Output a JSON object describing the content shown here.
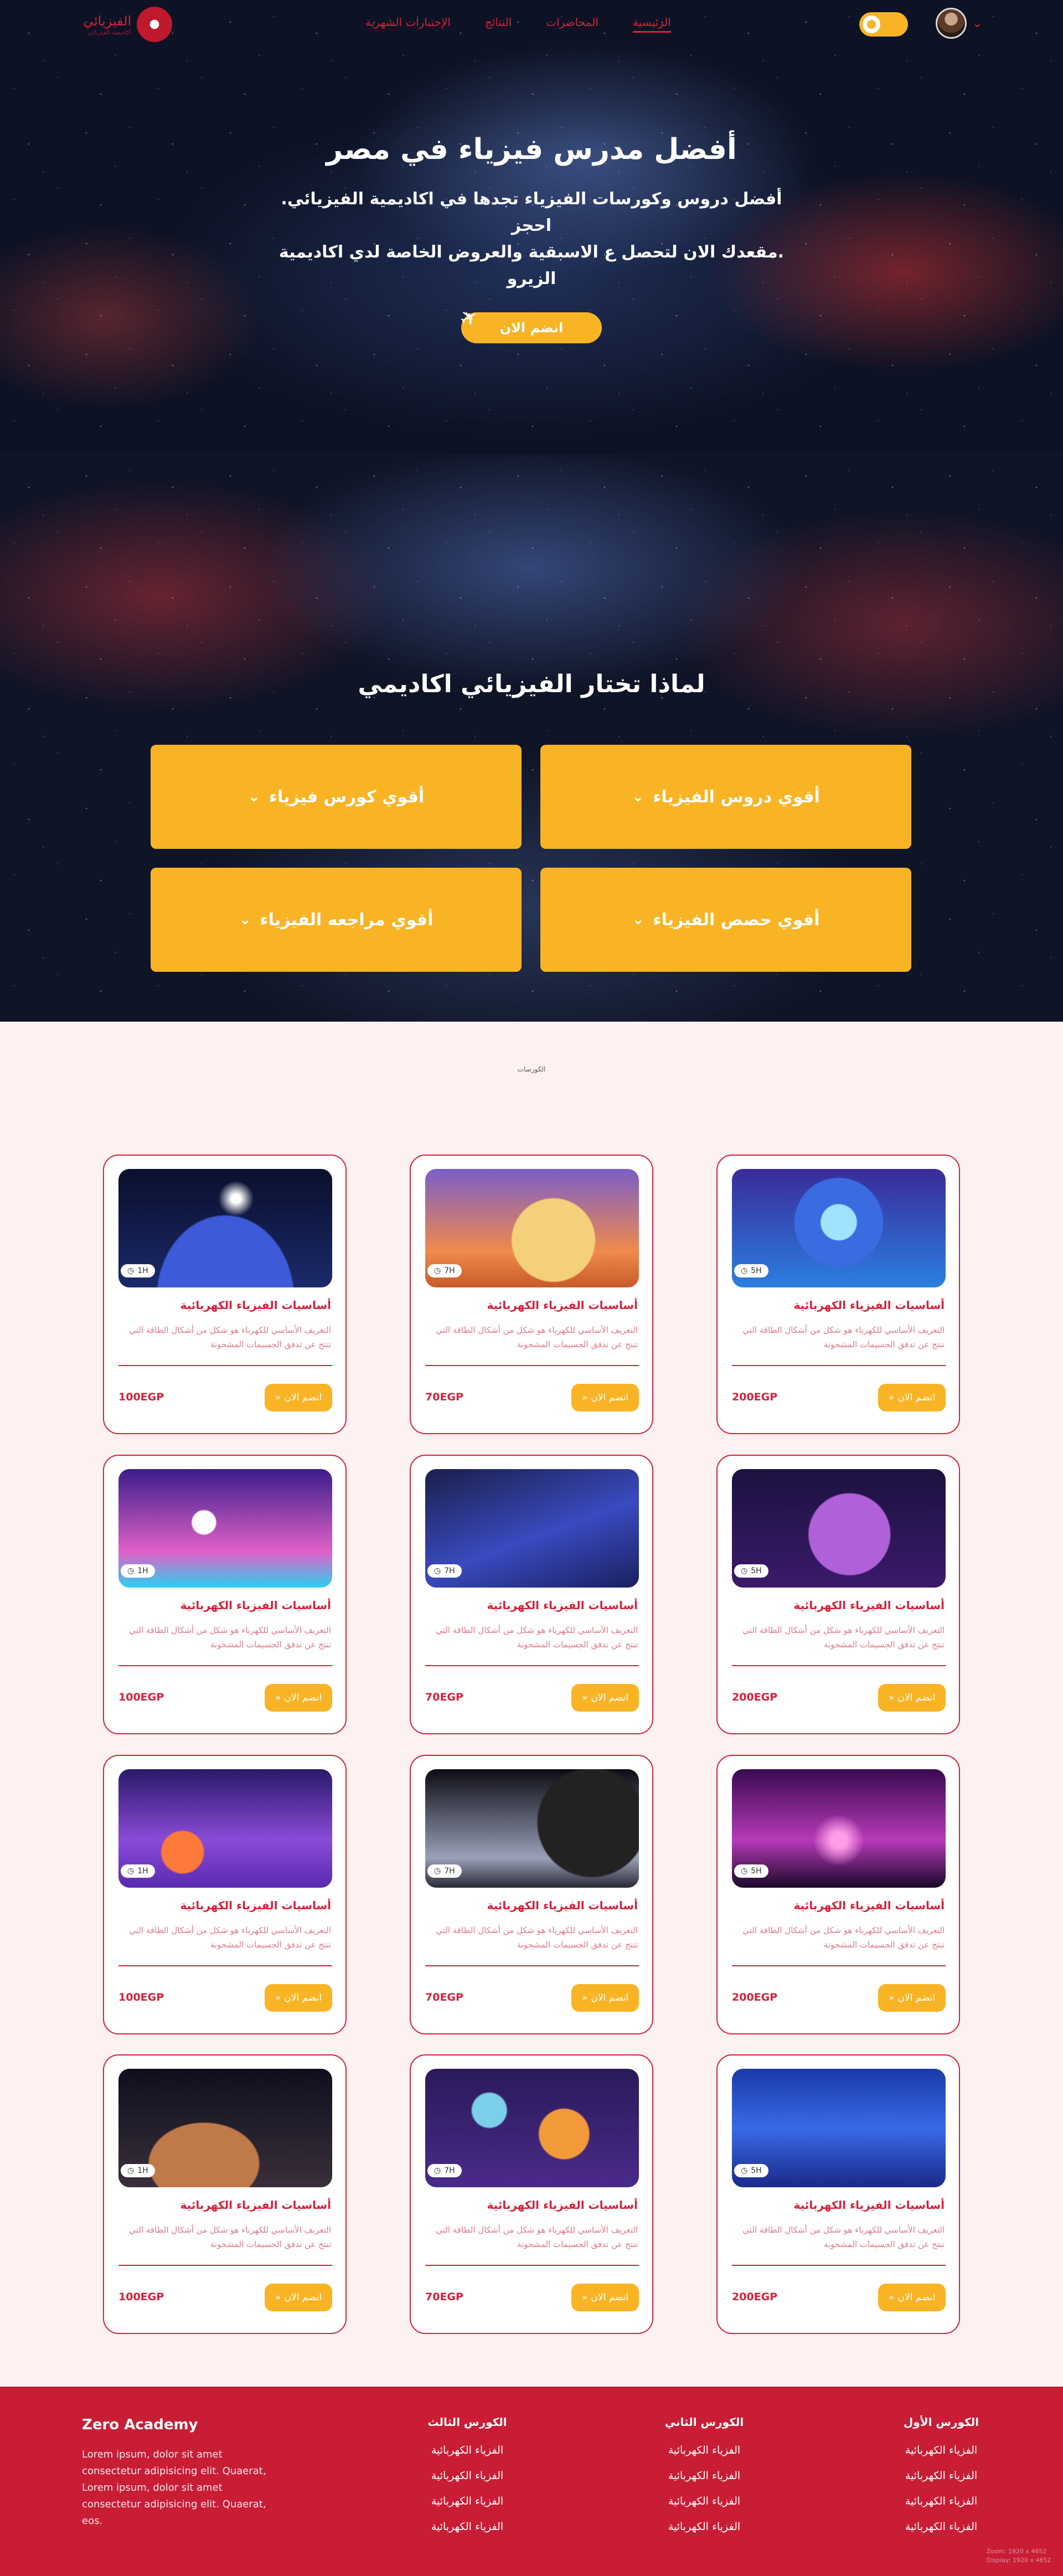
{
  "nav": {
    "links": [
      "الرئيسية",
      "المحاضرات",
      "النتائج",
      "الإختبارات الشهرية"
    ],
    "brand_title": "الفيزيائي",
    "brand_sub": "اكاديمية الفيزيائي",
    "theme_toggle": "sun-icon"
  },
  "hero": {
    "title": "أفضل مدرس فيزياء في مصر",
    "line1": "أفضل دروس وكورسات الفيزياء تجدها في اكاديمية الفيزيائي. احجز",
    "line2": ".مقعدك الان لتحصل ع الاسبقية والعروض الخاصة لدي اكاديمية الزيرو",
    "cta": "انضم الان"
  },
  "why": {
    "title": "لماذا تختار الفيزيائي اكاديمي",
    "features": [
      "أقوي دروس الفيزياء",
      "أقوي كورس فيزياء",
      "أقوي حصص الفيزياء",
      "أقوي مراجعه الفيزياء"
    ]
  },
  "courses_title": "الكورسات",
  "courses": [
    {
      "duration": "5H",
      "title": "أساسيات الفيزياء الكهربائية",
      "desc": "التعريف الأساسي للكهرباء هو شكل من أشكال الطاقة التي تنتج عن تدفق الجسيمات المشحونة",
      "price": "200EGP",
      "button": "انضم الان"
    },
    {
      "duration": "7H",
      "title": "أساسيات الفيزياء الكهربائية",
      "desc": "التعريف الأساسي للكهرباء هو شكل من أشكال الطاقة التي تنتج عن تدفق الجسيمات المشحونة",
      "price": "70EGP",
      "button": "انضم الان"
    },
    {
      "duration": "1H",
      "title": "أساسيات الفيزياء الكهربائية",
      "desc": "التعريف الأساسي للكهرباء هو شكل من أشكال الطاقة التي تنتج عن تدفق الجسيمات المشحونة",
      "price": "100EGP",
      "button": "انضم الان"
    },
    {
      "duration": "5H",
      "title": "أساسيات الفيزياء الكهربائية",
      "desc": "التعريف الأساسي للكهرباء هو شكل من أشكال الطاقة التي تنتج عن تدفق الجسيمات المشحونة",
      "price": "200EGP",
      "button": "انضم الان"
    },
    {
      "duration": "7H",
      "title": "أساسيات الفيزياء الكهربائية",
      "desc": "التعريف الأساسي للكهرباء هو شكل من أشكال الطاقة التي تنتج عن تدفق الجسيمات المشحونة",
      "price": "70EGP",
      "button": "انضم الان"
    },
    {
      "duration": "1H",
      "title": "أساسيات الفيزياء الكهربائية",
      "desc": "التعريف الأساسي للكهرباء هو شكل من أشكال الطاقة التي تنتج عن تدفق الجسيمات المشحونة",
      "price": "100EGP",
      "button": "انضم الان"
    },
    {
      "duration": "5H",
      "title": "أساسيات الفيزياء الكهربائية",
      "desc": "التعريف الأساسي للكهرباء هو شكل من أشكال الطاقة التي تنتج عن تدفق الجسيمات المشحونة",
      "price": "200EGP",
      "button": "انضم الان"
    },
    {
      "duration": "7H",
      "title": "أساسيات الفيزياء الكهربائية",
      "desc": "التعريف الأساسي للكهرباء هو شكل من أشكال الطاقة التي تنتج عن تدفق الجسيمات المشحونة",
      "price": "70EGP",
      "button": "انضم الان"
    },
    {
      "duration": "1H",
      "title": "أساسيات الفيزياء الكهربائية",
      "desc": "التعريف الأساسي للكهرباء هو شكل من أشكال الطاقة التي تنتج عن تدفق الجسيمات المشحونة",
      "price": "100EGP",
      "button": "انضم الان"
    },
    {
      "duration": "5H",
      "title": "أساسيات الفيزياء الكهربائية",
      "desc": "التعريف الأساسي للكهرباء هو شكل من أشكال الطاقة التي تنتج عن تدفق الجسيمات المشحونة",
      "price": "200EGP",
      "button": "انضم الان"
    },
    {
      "duration": "7H",
      "title": "أساسيات الفيزياء الكهربائية",
      "desc": "التعريف الأساسي للكهرباء هو شكل من أشكال الطاقة التي تنتج عن تدفق الجسيمات المشحونة",
      "price": "70EGP",
      "button": "انضم الان"
    },
    {
      "duration": "1H",
      "title": "أساسيات الفيزياء الكهربائية",
      "desc": "التعريف الأساسي للكهرباء هو شكل من أشكال الطاقة التي تنتج عن تدفق الجسيمات المشحونة",
      "price": "100EGP",
      "button": "انضم الان"
    }
  ],
  "footer": {
    "about_title": "Zero Academy",
    "about_text": "Lorem ipsum, dolor sit amet consectetur adipisicing elit. Quaerat, Lorem ipsum, dolor sit amet consectetur adipisicing elit. Quaerat, eos.",
    "columns": [
      {
        "title": "الكورس الأول",
        "items": [
          "الفزياء الكهربائية",
          "الفزياء الكهربائية",
          "الفزياء الكهربائية",
          "الفزياء الكهربائية"
        ]
      },
      {
        "title": "الكورس الثاني",
        "items": [
          "الفزياء الكهربائية",
          "الفزياء الكهربائية",
          "الفزياء الكهربائية",
          "الفزياء الكهربائية"
        ]
      },
      {
        "title": "الكورس الثالث",
        "items": [
          "الفزياء الكهربائية",
          "الفزياء الكهربائية",
          "الفزياء الكهربائية",
          "الفزياء الكهربائية"
        ]
      }
    ]
  },
  "watermark": [
    "Zoom: 1920 x 4652",
    "Display: 1920 x 4652"
  ],
  "colors": {
    "primary": "#c81d35",
    "accent": "#f8b425",
    "page_bg": "#fdf1f1"
  }
}
